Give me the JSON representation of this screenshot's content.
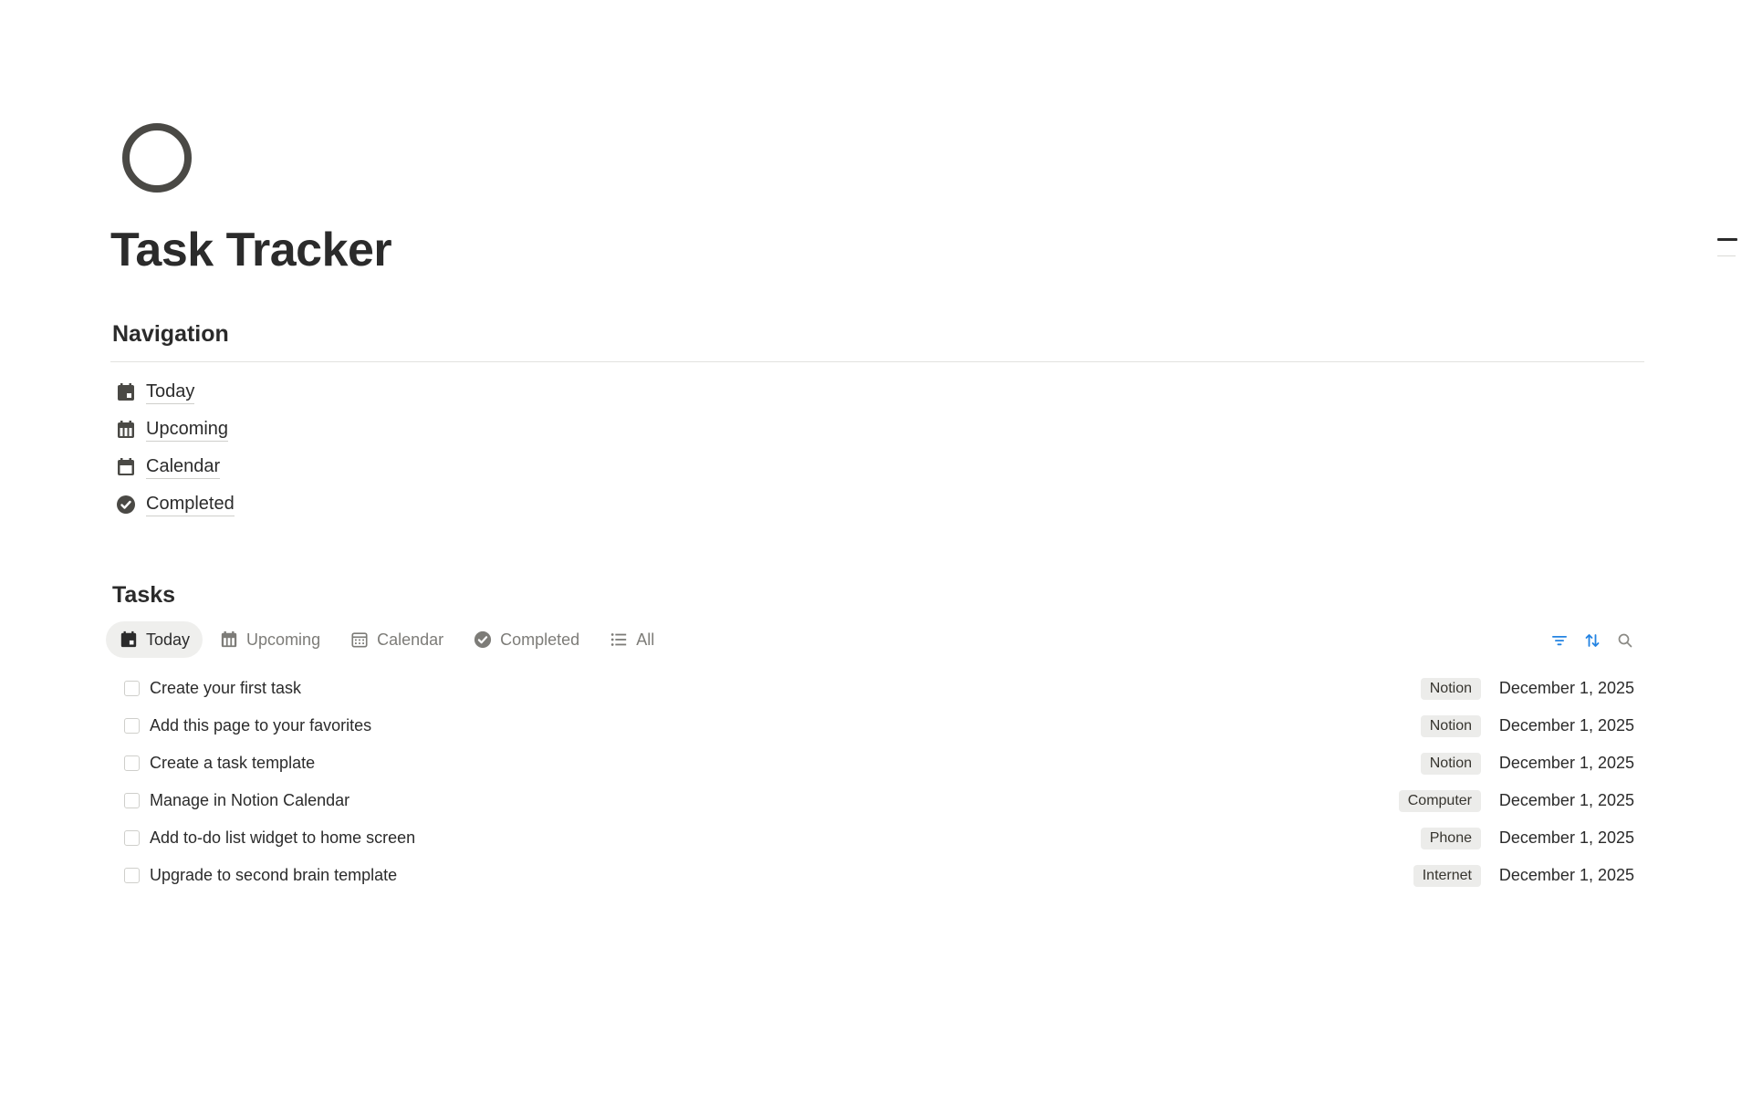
{
  "page": {
    "title": "Task Tracker",
    "icon": "circle-outline-icon"
  },
  "navigation": {
    "heading": "Navigation",
    "items": [
      {
        "label": "Today",
        "icon": "calendar-today-icon"
      },
      {
        "label": "Upcoming",
        "icon": "calendar-week-icon"
      },
      {
        "label": "Calendar",
        "icon": "calendar-icon"
      },
      {
        "label": "Completed",
        "icon": "check-circle-icon"
      }
    ]
  },
  "tasks": {
    "heading": "Tasks",
    "tabs": [
      {
        "label": "Today",
        "icon": "calendar-today-icon",
        "active": true
      },
      {
        "label": "Upcoming",
        "icon": "calendar-week-icon",
        "active": false
      },
      {
        "label": "Calendar",
        "icon": "calendar-grid-icon",
        "active": false
      },
      {
        "label": "Completed",
        "icon": "check-circle-icon",
        "active": false
      },
      {
        "label": "All",
        "icon": "list-icon",
        "active": false
      }
    ],
    "toolbar": {
      "filter_icon": "filter-icon",
      "sort_icon": "sort-icon",
      "search_icon": "search-icon",
      "accent": "#2383e2"
    },
    "rows": [
      {
        "title": "Create your first task",
        "tag": "Notion",
        "date": "December 1, 2025",
        "done": false
      },
      {
        "title": "Add this page to your favorites",
        "tag": "Notion",
        "date": "December 1, 2025",
        "done": false
      },
      {
        "title": "Create a task template",
        "tag": "Notion",
        "date": "December 1, 2025",
        "done": false
      },
      {
        "title": "Manage in Notion Calendar",
        "tag": "Computer",
        "date": "December 1, 2025",
        "done": false
      },
      {
        "title": "Add to-do list widget to home screen",
        "tag": "Phone",
        "date": "December 1, 2025",
        "done": false
      },
      {
        "title": "Upgrade to second brain template",
        "tag": "Internet",
        "date": "December 1, 2025",
        "done": false
      }
    ]
  }
}
